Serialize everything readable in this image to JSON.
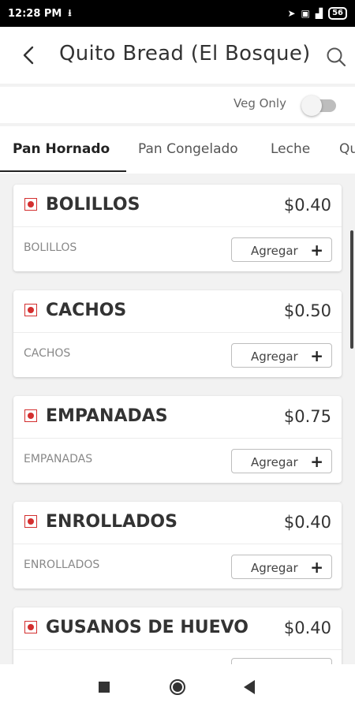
{
  "status_bar": {
    "time": "12:28 PM",
    "battery": "56",
    "icons": [
      "download-icon",
      "location-icon",
      "sim-icon",
      "signal-icon",
      "battery-icon"
    ]
  },
  "header": {
    "title": "Quito Bread (El Bosque)",
    "back_icon": "back-arrow-icon",
    "search_icon": "search-icon"
  },
  "filter": {
    "veg_only_label": "Veg Only",
    "veg_only_enabled": false
  },
  "tabs": [
    {
      "label": "Pan Hornado",
      "active": true
    },
    {
      "label": "Pan Congelado",
      "active": false
    },
    {
      "label": "Leche",
      "active": false
    },
    {
      "label": "Qu",
      "active": false
    }
  ],
  "items": [
    {
      "name": "BOLILLOS",
      "price": "$0.40",
      "description": "BOLILLOS",
      "add_label": "Agregar",
      "add_icon": "+"
    },
    {
      "name": "CACHOS",
      "price": "$0.50",
      "description": "CACHOS",
      "add_label": "Agregar",
      "add_icon": "+"
    },
    {
      "name": "EMPANADAS",
      "price": "$0.75",
      "description": "EMPANADAS",
      "add_label": "Agregar",
      "add_icon": "+"
    },
    {
      "name": "ENROLLADOS",
      "price": "$0.40",
      "description": "ENROLLADOS",
      "add_label": "Agregar",
      "add_icon": "+"
    },
    {
      "name": "GUSANOS DE HUEVO",
      "price": "$0.40",
      "description": "",
      "add_label": "",
      "add_icon": ""
    }
  ],
  "colors": {
    "non_veg_mark": "#d32f2f",
    "active_tab": "#222222",
    "toggle_off": "#bdbdbd"
  }
}
